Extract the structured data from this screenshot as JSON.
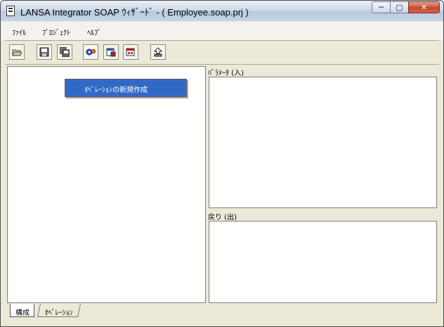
{
  "window": {
    "title": "LANSA Integrator SOAP ｳｨｻﾞｰﾄﾞ - ( Employee.soap.prj )",
    "controls": {
      "minimize": "─",
      "maximize": "▢",
      "close": "✕"
    }
  },
  "menu": {
    "items": [
      "ﾌｧｲﾙ",
      "ﾌﾟﾛｼﾞｪｸﾄ",
      "ﾍﾙﾌﾟ"
    ]
  },
  "toolbar": {
    "buttons": [
      "open-icon",
      "save-icon",
      "save-all-icon",
      "gears-icon",
      "window-export-icon",
      "window-settings-icon",
      "upload-icon"
    ]
  },
  "context_menu": {
    "item": "ｵﾍﾟﾚｰｼｮﾝの新規作成"
  },
  "right_panel": {
    "params_in_label": "ﾊﾟﾗﾒｰﾀ (入)",
    "return_out_label": "戻り (出)"
  },
  "tabs": [
    "構成",
    "ｵﾍﾟﾚｰｼｮﾝ"
  ],
  "colors": {
    "selection": "#316ac5",
    "window_bg": "#ece9d8",
    "close_button": "#c74a32"
  }
}
